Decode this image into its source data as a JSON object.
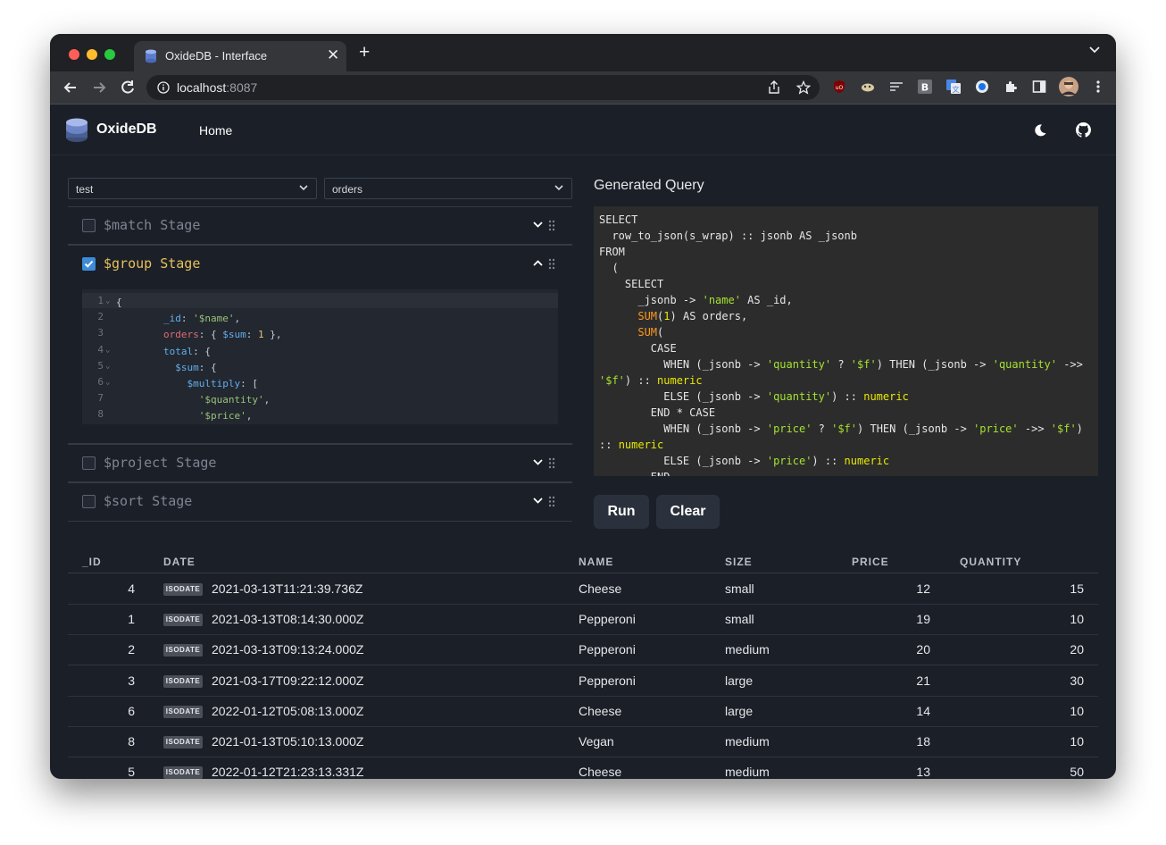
{
  "browser": {
    "tab_title": "OxideDB - Interface",
    "url_host": "localhost",
    "url_port": ":8087"
  },
  "app": {
    "brand": "OxideDB",
    "nav_home": "Home"
  },
  "selectors": {
    "database": "test",
    "collection": "orders"
  },
  "stages": [
    {
      "label": "$match Stage",
      "checked": false
    },
    {
      "label": "$group Stage",
      "checked": true
    },
    {
      "label": "$project Stage",
      "checked": false
    },
    {
      "label": "$sort Stage",
      "checked": false
    }
  ],
  "editor": {
    "line_numbers": [
      "1",
      "2",
      "3",
      "4",
      "5",
      "6",
      "7",
      "8"
    ]
  },
  "generated_query": {
    "title": "Generated Query"
  },
  "buttons": {
    "run": "Run",
    "clear": "Clear"
  },
  "table": {
    "headers": [
      "_ID",
      "DATE",
      "NAME",
      "SIZE",
      "PRICE",
      "QUANTITY"
    ],
    "badge": "ISODATE",
    "rows": [
      {
        "id": "4",
        "date": "2021-03-13T11:21:39.736Z",
        "name": "Cheese",
        "size": "small",
        "price": "12",
        "quantity": "15"
      },
      {
        "id": "1",
        "date": "2021-03-13T08:14:30.000Z",
        "name": "Pepperoni",
        "size": "small",
        "price": "19",
        "quantity": "10"
      },
      {
        "id": "2",
        "date": "2021-03-13T09:13:24.000Z",
        "name": "Pepperoni",
        "size": "medium",
        "price": "20",
        "quantity": "20"
      },
      {
        "id": "3",
        "date": "2021-03-17T09:22:12.000Z",
        "name": "Pepperoni",
        "size": "large",
        "price": "21",
        "quantity": "30"
      },
      {
        "id": "6",
        "date": "2022-01-12T05:08:13.000Z",
        "name": "Cheese",
        "size": "large",
        "price": "14",
        "quantity": "10"
      },
      {
        "id": "8",
        "date": "2021-01-13T05:10:13.000Z",
        "name": "Vegan",
        "size": "medium",
        "price": "18",
        "quantity": "10"
      },
      {
        "id": "5",
        "date": "2022-01-12T21:23:13.331Z",
        "name": "Cheese",
        "size": "medium",
        "price": "13",
        "quantity": "50"
      }
    ]
  },
  "colors": {
    "app_bg": "#1b1f27",
    "accent_checkbox": "#3d8bd9",
    "active_stage": "#e5c05b"
  }
}
